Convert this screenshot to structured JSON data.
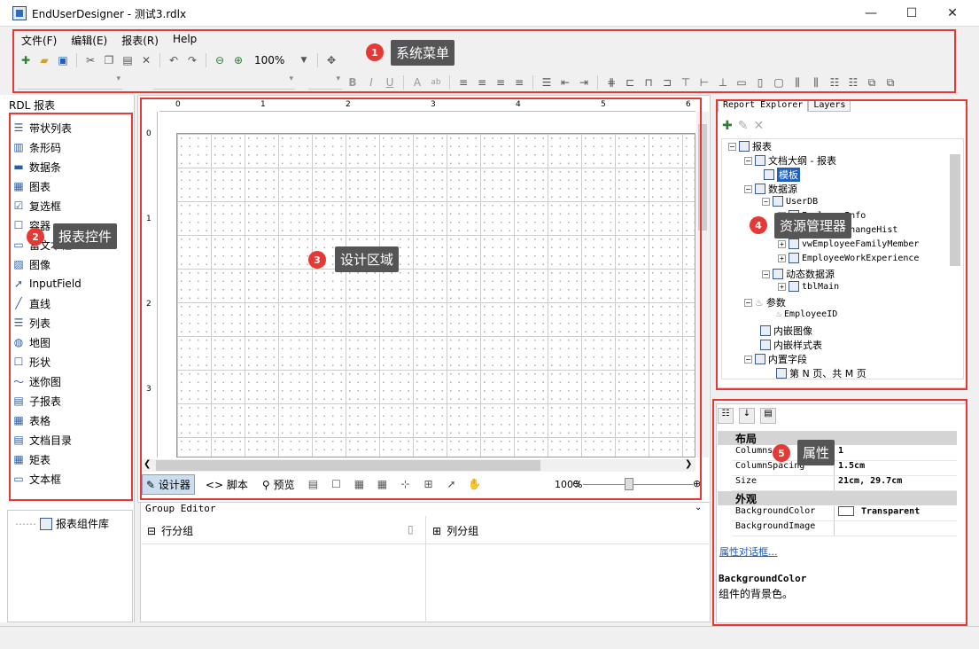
{
  "window": {
    "title": "EndUserDesigner - 测试3.rdlx",
    "minimize": "—",
    "maximize": "☐",
    "close": "✕"
  },
  "menu": [
    "文件(F)",
    "编辑(E)",
    "报表(R)",
    "Help"
  ],
  "toolbar": {
    "zoom": "100%"
  },
  "callouts": {
    "c1": {
      "num": "1",
      "label": "系统菜单"
    },
    "c2": {
      "num": "2",
      "label": "报表控件"
    },
    "c3": {
      "num": "3",
      "label": "设计区域"
    },
    "c4": {
      "num": "4",
      "label": "资源管理器"
    },
    "c5": {
      "num": "5",
      "label": "属性"
    }
  },
  "left_panel": {
    "title": "RDL 报表",
    "controls": [
      "带状列表",
      "条形码",
      "数据条",
      "图表",
      "复选框",
      "容器",
      "富文本框",
      "图像",
      "InputField",
      "直线",
      "列表",
      "地图",
      "形状",
      "迷你图",
      "子报表",
      "表格",
      "文档目录",
      "矩表",
      "文本框"
    ],
    "library": "报表组件库"
  },
  "ruler": {
    "top": [
      "0",
      "1",
      "2",
      "3",
      "4",
      "5",
      "6"
    ],
    "left": [
      "0",
      "1",
      "2",
      "3"
    ]
  },
  "design_tabs": {
    "designer": "设计器",
    "script": "脚本",
    "preview": "预览",
    "zoom": "100%"
  },
  "group_editor": {
    "title": "Group Editor",
    "row_groups": "行分组",
    "col_groups": "列分组"
  },
  "explorer": {
    "tabs": [
      "Report Explorer",
      "Layers"
    ],
    "tree": {
      "report": "报表",
      "outline": "文档大纲 - 报表",
      "template": "模板",
      "datasources": "数据源",
      "userdb": "UserDB",
      "ds1": "EmployeeInfo",
      "ds2": "PositionChangeHist",
      "ds3": "vwEmployeeFamilyMember",
      "ds4": "EmployeeWorkExperience",
      "dynamic": "动态数据源",
      "tblmain": "tblMain",
      "params": "参数",
      "empid": "EmployeeID",
      "images": "内嵌图像",
      "styles": "内嵌样式表",
      "fields": "内置字段",
      "pagen": "第 N 页、共 M 页"
    }
  },
  "properties": {
    "cat_layout": "布局",
    "rows": [
      {
        "name": "Columns",
        "value": "1"
      },
      {
        "name": "ColumnSpacing",
        "value": "1.5cm"
      },
      {
        "name": "Size",
        "value": "21cm, 29.7cm"
      }
    ],
    "cat_appearance": "外观",
    "rows2": [
      {
        "name": "BackgroundColor",
        "value": "Transparent"
      },
      {
        "name": "BackgroundImage",
        "value": ""
      }
    ],
    "dialog_link": "属性对话框...",
    "desc_title": "BackgroundColor",
    "desc_text": "组件的背景色。"
  },
  "colors": {
    "accent_red": "#e53935",
    "callout_bg": "#555555"
  }
}
